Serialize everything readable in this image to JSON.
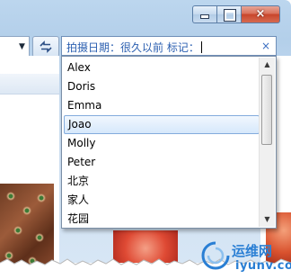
{
  "window": {
    "buttons": {
      "minimize": "minimize",
      "maximize": "maximize",
      "close": "×"
    }
  },
  "search": {
    "text": "拍摄日期：很久以前 标记：",
    "clear_symbol": "×"
  },
  "dropdown": {
    "items": [
      {
        "label": "Alex"
      },
      {
        "label": "Doris"
      },
      {
        "label": "Emma"
      },
      {
        "label": "Joao",
        "selected": true
      },
      {
        "label": "Molly"
      },
      {
        "label": "Peter"
      },
      {
        "label": "北京"
      },
      {
        "label": "家人"
      },
      {
        "label": "花园"
      }
    ]
  },
  "watermark": {
    "cn": "运维网",
    "en": "iyunv.com"
  },
  "colors": {
    "title_bar": "#b9d3ec",
    "search_text": "#2b5fb0",
    "selection": "#d6e8fb",
    "watermark": "#2a7fd4"
  }
}
